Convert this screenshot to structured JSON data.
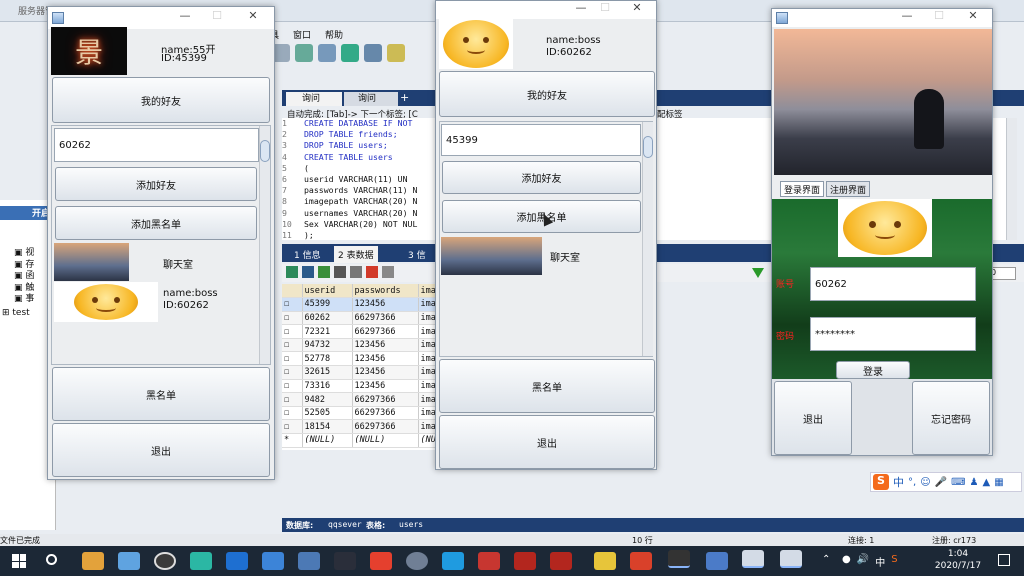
{
  "colors": {
    "accent": "#1d5bb8",
    "desktop": "#7f95b5",
    "taskbar": "#1c2836",
    "lime": "#22c95a"
  },
  "background_app": {
    "title": "服务器管理器",
    "menu": [
      "具",
      "窗口",
      "帮助"
    ],
    "tabs": [
      "询问",
      "询问"
    ],
    "autocomplete": "自动完成: [Tab]-> 下一个标签; [C",
    "autocomplete_tail": "配标签",
    "code_lines": [
      {
        "n": "1",
        "text": "CREATE DATABASE IF NOT",
        "kw": true
      },
      {
        "n": "2",
        "text": "DROP TABLE friends;",
        "kw": true
      },
      {
        "n": "3",
        "text": "DROP TABLE users;",
        "kw": true
      },
      {
        "n": "4",
        "text": "CREATE TABLE users",
        "kw": true
      },
      {
        "n": "5",
        "text": "(",
        "kw": false
      },
      {
        "n": "6",
        "text": "userid  VARCHAR(11) UN",
        "kw": false
      },
      {
        "n": "7",
        "text": "passwords VARCHAR(11) N",
        "kw": false
      },
      {
        "n": "8",
        "text": "imagepath VARCHAR(20) N",
        "kw": false
      },
      {
        "n": "9",
        "text": "usernames VARCHAR(20) N",
        "kw": false
      },
      {
        "n": "10",
        "text": "Sex VARCHAR(20) NOT NUL",
        "kw": false
      },
      {
        "n": "11",
        "text": ");",
        "kw": false
      }
    ],
    "result_tabs": [
      "1 信息",
      "2 表数据",
      "3 信"
    ],
    "columns": [
      "userid",
      "passwords",
      "ima"
    ],
    "rows": [
      [
        "45399",
        "123456",
        "ima"
      ],
      [
        "60262",
        "66297366",
        "ima"
      ],
      [
        "72321",
        "66297366",
        "ima"
      ],
      [
        "94732",
        "123456",
        "ima"
      ],
      [
        "52778",
        "123456",
        "ima"
      ],
      [
        "32615",
        "123456",
        "ima"
      ],
      [
        "73316",
        "123456",
        "ima"
      ],
      [
        "9482",
        "66297366",
        "ima"
      ],
      [
        "52505",
        "66297366",
        "ima"
      ],
      [
        "18154",
        "66297366",
        "ima"
      ],
      [
        "(NULL)",
        "(NULL)",
        "(NU"
      ]
    ],
    "status_db_label": "数据库:",
    "status_db": "qqsever",
    "status_table_label": "表格:",
    "status_table": "users",
    "status_rows": "10 行",
    "status_conn": "连接: 1",
    "status_reg": "注册: cr173",
    "status_left": "文件已完成",
    "tree_header": "开启",
    "tree_items": [
      "视",
      "存",
      "函",
      "触",
      "事",
      "test"
    ],
    "filter_value": "0"
  },
  "win1": {
    "name_label": "name:55开",
    "id_label": "ID:45399",
    "avatar_char": "景",
    "btn_friends": "我的好友",
    "input_value": "60262",
    "btn_add_friend": "添加好友",
    "btn_add_black": "添加黑名单",
    "chatroom": "聊天室",
    "friend_name": "name:boss",
    "friend_id": "ID:60262",
    "btn_blacklist": "黑名单",
    "btn_exit": "退出"
  },
  "win2": {
    "name_label": "name:boss",
    "id_label": "ID:60262",
    "btn_friends": "我的好友",
    "input_value": "45399",
    "btn_add_friend": "添加好友",
    "btn_add_black": "添加黑名单",
    "chatroom": "聊天室",
    "btn_blacklist": "黑名单",
    "btn_exit": "退出"
  },
  "login": {
    "tab_login": "登录界面",
    "tab_register": "注册界面",
    "label_account": "账号",
    "label_password": "密码",
    "account_value": "60262",
    "password_value": "********",
    "btn_login": "登录",
    "btn_exit": "退出",
    "btn_forgot": "忘记密码"
  },
  "ime": {
    "logo": "S",
    "lang": "中"
  },
  "tray": {
    "time": "1:04",
    "date": "2020/7/17",
    "lang": "中"
  }
}
